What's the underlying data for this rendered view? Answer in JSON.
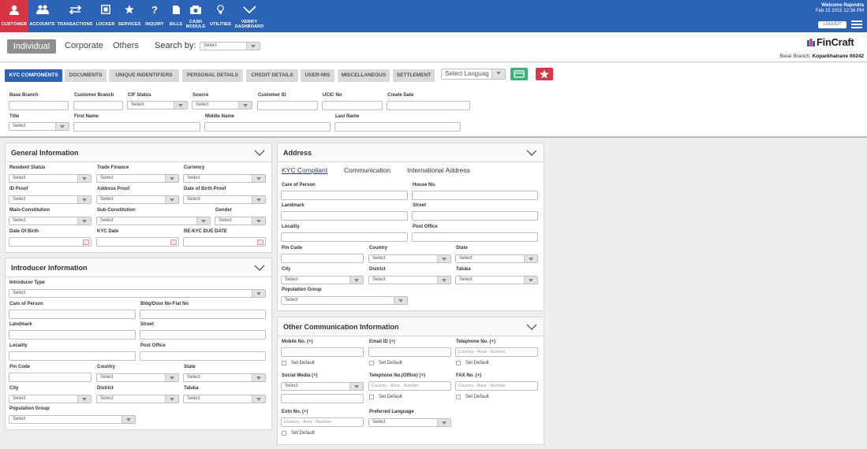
{
  "nav": [
    {
      "label": "CUSTOMER",
      "icon": "user-icon"
    },
    {
      "label": "ACCOUNTS",
      "icon": "users-icon"
    },
    {
      "label": "TRANSACTIONS",
      "icon": "transfer-arrows-icon"
    },
    {
      "label": "LOCKER",
      "icon": "safe-icon"
    },
    {
      "label": "SERVICES",
      "icon": "star-icon"
    },
    {
      "label": "INQUIRY",
      "icon": "question-icon"
    },
    {
      "label": "BILLS",
      "icon": "document-icon"
    },
    {
      "label": "CASH MODULE",
      "icon": "cash-register-icon"
    },
    {
      "label": "UTILITIES",
      "icon": "lightbulb-icon"
    },
    {
      "label": "VERIFY DASHBOARD",
      "icon": "checkmark-icon"
    }
  ],
  "header": {
    "welcome": "Welcome Rajendra",
    "datetime": "Feb 15 2015 12:36 PM",
    "logout": "LOGOUT"
  },
  "subbar": {
    "tabs": [
      "Individual",
      "Corporate",
      "Others"
    ],
    "search_label": "Search by:",
    "search_select": "Select",
    "logo": "FinCraft",
    "branch_label": "Base Branch:",
    "branch_value": "Koparkhairane 00242"
  },
  "kyc_tabs": [
    "KYC COMPONENTS",
    "DOCUMENTS",
    "UNIQUE INDENTIFIERS",
    "PERSONAL DETAILS",
    "CREDIT DETAILS",
    "USER-MIS",
    "MISCELLANEOUS",
    "SETTLEMENT"
  ],
  "language_select": "Select Languag",
  "top_form": {
    "base_branch": "Base Branch",
    "customer_branch": "Customer Branch",
    "cif_status": "CIF Status",
    "source": "Source",
    "customer_id": "Customer ID",
    "ucic_no": "UCIC No",
    "create_date": "Create Date",
    "title": "Title",
    "first_name": "First Name",
    "middle_name": "Middle Name",
    "last_name": "Last Name",
    "select": "Select"
  },
  "general": {
    "title": "General Information",
    "resident_status": "Resident Status",
    "trade_finance": "Trade Finance",
    "currency": "Currency",
    "id_proof": "ID Proof",
    "address_proof": "Address Proof",
    "dob_proof": "Date of Birth Proof",
    "main_constitution": "Main-Constitution",
    "sub_constitution": "Sub-Constitution",
    "gender": "Gender",
    "dob": "Date Of Birth",
    "kyc_date": "KYC Date",
    "rekyc": "RE-KYC DUE DATE"
  },
  "introducer": {
    "title": "Introducer Information",
    "type": "Introducer Type",
    "care_of": "Care of Person",
    "bldg": "Bldg/Door No-Flat No",
    "landmark": "Landmark",
    "street": "Street",
    "locality": "Locality",
    "post_office": "Post Office",
    "pin": "Pin Code",
    "country": "Country",
    "state": "State",
    "city": "City",
    "district": "District",
    "taluka": "Taluka",
    "population": "Population Group"
  },
  "address": {
    "title": "Address",
    "tabs": [
      "KYC Compliant",
      "Communication",
      "International Address"
    ],
    "care_of": "Care of Person",
    "house_no": "House No.",
    "landmark": "Landmark",
    "street": "Street",
    "locality": "Locality",
    "post_office": "Post Office",
    "pin": "Pin Code",
    "country": "Country",
    "state": "State",
    "city": "City",
    "district": "District",
    "taluka": "Taluka",
    "population": "Population Group"
  },
  "other_comm": {
    "title": "Other Communication Information",
    "mobile": "Mobile No. (+)",
    "email": "Email ID (+)",
    "telephone": "Telephone No. (+)",
    "set_default": "Set Default",
    "phone_placeholder": "Country - Area - Number",
    "social": "Social Media (+)",
    "tel_office": "Telephone No.(Office) (+)",
    "fax": "FAX No. (+)",
    "extn": "Extn No. (+)",
    "pref_lang": "Preferred Language"
  }
}
